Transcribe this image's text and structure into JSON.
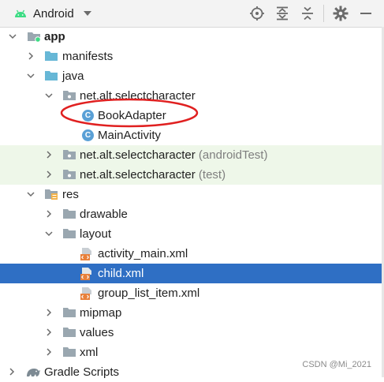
{
  "toolbar": {
    "view_title": "Android",
    "buttons": [
      {
        "name": "locate-icon"
      },
      {
        "name": "expand-all-icon"
      },
      {
        "name": "collapse-all-icon"
      },
      {
        "name": "gear-icon"
      },
      {
        "name": "hide-icon"
      }
    ]
  },
  "tree": {
    "app": "app",
    "manifests": "manifests",
    "java": "java",
    "pkg_main": "net.alt.selectcharacter",
    "book_adapter": "BookAdapter",
    "main_activity": "MainActivity",
    "pkg_android_test": "net.alt.selectcharacter",
    "pkg_android_test_suffix": "(androidTest)",
    "pkg_test": "net.alt.selectcharacter",
    "pkg_test_suffix": "(test)",
    "res": "res",
    "drawable": "drawable",
    "layout": "layout",
    "activity_main": "activity_main.xml",
    "child": "child.xml",
    "group_list_item": "group_list_item.xml",
    "mipmap": "mipmap",
    "values": "values",
    "xml": "xml",
    "gradle_scripts": "Gradle Scripts"
  },
  "class_badge": "C",
  "selected_item": "child.xml",
  "colors": {
    "selection": "#2f6fc4",
    "test_row_bg": "#eef7e9",
    "annotation": "#e02020",
    "android_green": "#3ddc84"
  },
  "watermark": "CSDN @Mi_2021"
}
